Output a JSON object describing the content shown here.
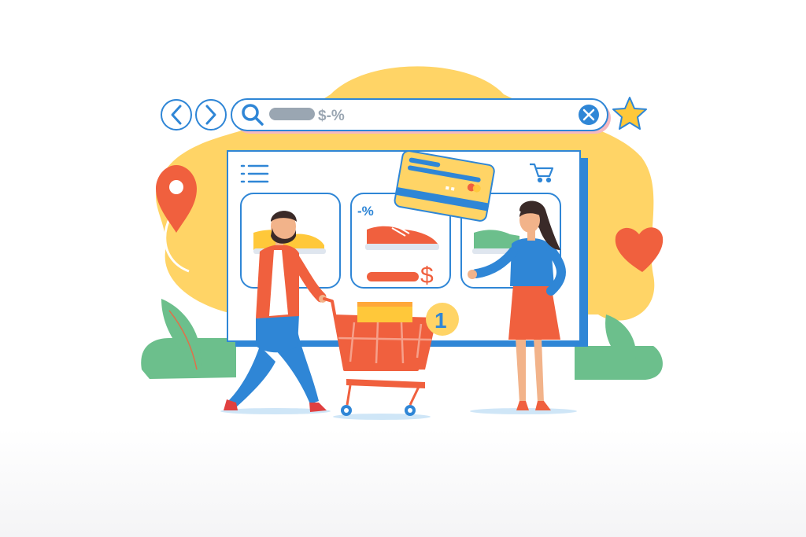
{
  "search": {
    "query": "$-%"
  },
  "product_discount": "-%",
  "product_price_symbol": "$",
  "cart_badge_count": "1",
  "icons": [
    "back-arrow-icon",
    "forward-arrow-icon",
    "search-icon",
    "clear-icon",
    "star-icon",
    "menu-icon",
    "cart-icon",
    "location-pin-icon",
    "heart-icon",
    "credit-card-icon"
  ],
  "colors": {
    "accent_blue": "#2f86d6",
    "blob_yellow": "#ffd466",
    "coral": "#f0603e",
    "leaf_green": "#6cbf8c"
  }
}
